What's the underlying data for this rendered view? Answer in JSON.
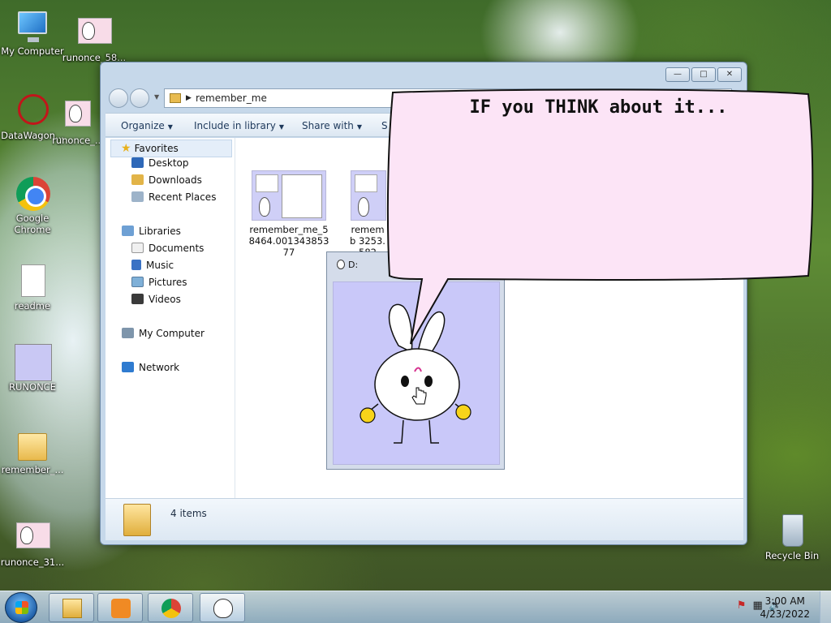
{
  "desktop": {
    "icons": [
      {
        "label": "My Computer"
      },
      {
        "label": "runonce_58..."
      },
      {
        "label": "DataWagon..."
      },
      {
        "label": "runonce_..."
      },
      {
        "label": "Google Chrome"
      },
      {
        "label": "readme"
      },
      {
        "label": "RUNONCE"
      },
      {
        "label": "remember_..."
      },
      {
        "label": "runonce_31..."
      },
      {
        "label": "Recycle Bin"
      }
    ]
  },
  "explorer": {
    "path": "remember_me",
    "toolbar": {
      "organize": "Organize",
      "include": "Include in library",
      "share": "Share with",
      "partial": "S"
    },
    "nav": {
      "favorites": "Favorites",
      "desktop": "Desktop",
      "downloads": "Downloads",
      "recent": "Recent Places",
      "libraries": "Libraries",
      "documents": "Documents",
      "music": "Music",
      "pictures": "Pictures",
      "videos": "Videos",
      "computer": "My Computer",
      "network": "Network"
    },
    "files": [
      {
        "name": "remember_me_58464.00134385377"
      },
      {
        "name": "rememb 3253.582"
      }
    ],
    "status": "4 items"
  },
  "popup": {
    "title": "D:",
    "bubble_text": "IF you THINK about it..."
  },
  "taskbar": {
    "time": "3:00 AM",
    "date": "4/23/2022"
  },
  "colors": {
    "bubble_fill": "#fce4f6",
    "canvas_bg": "#c9c8f9",
    "bunny_mitten": "#f8d41a"
  }
}
